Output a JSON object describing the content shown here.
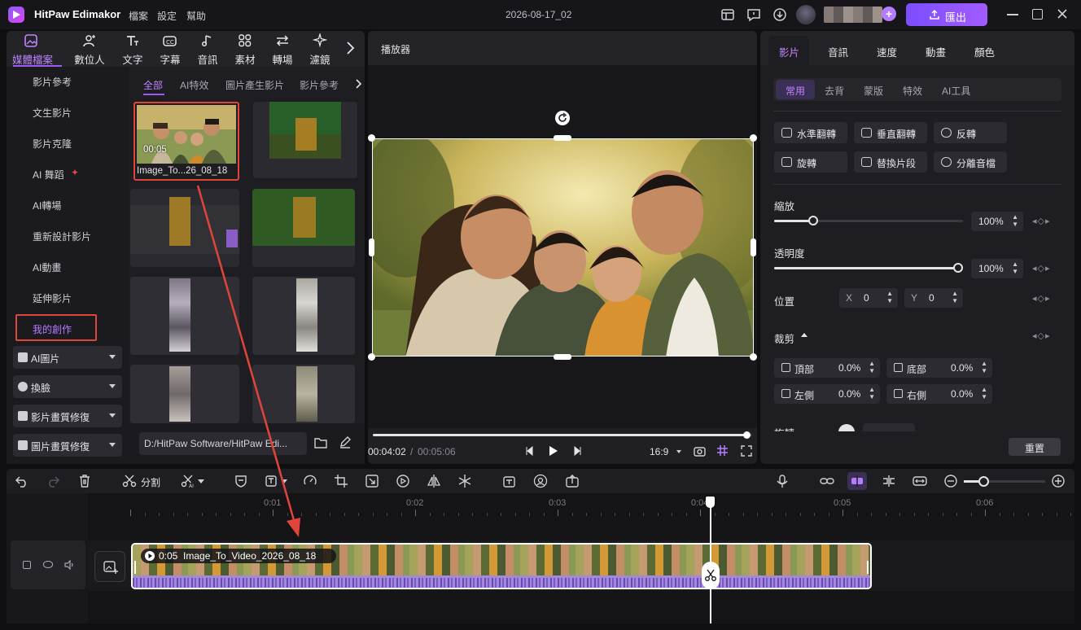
{
  "app": {
    "name": "HitPaw Edimakor",
    "menu": [
      "檔案",
      "設定",
      "幫助"
    ],
    "project_title": "2026-08-17_02",
    "export_label": "匯出"
  },
  "media_tabs": [
    {
      "label": "媒體檔案",
      "icon": "media-icon",
      "active": true
    },
    {
      "label": "數位人",
      "icon": "avatar-person-icon"
    },
    {
      "label": "文字",
      "icon": "text-icon"
    },
    {
      "label": "字幕",
      "icon": "subtitle-icon"
    },
    {
      "label": "音訊",
      "icon": "music-icon"
    },
    {
      "label": "素材",
      "icon": "elements-icon"
    },
    {
      "label": "轉場",
      "icon": "transition-icon"
    },
    {
      "label": "濾鏡",
      "icon": "filter-icon"
    }
  ],
  "sidebar": {
    "items": [
      "影片參考",
      "文生影片",
      "影片克隆",
      "AI 舞蹈",
      "AI轉場",
      "重新設計影片",
      "AI動畫",
      "延伸影片",
      "我的創作"
    ],
    "dropdowns": [
      "AI圖片",
      "換臉",
      "影片畫質修復",
      "圖片畫質修復"
    ]
  },
  "media_subtabs": [
    "全部",
    "AI特效",
    "圖片產生影片",
    "影片參考"
  ],
  "media_card": {
    "duration": "00:05",
    "name": "Image_To...26_08_18"
  },
  "media_path": "D:/HitPaw Software/HitPaw Edi...",
  "player": {
    "title": "播放器",
    "current_time": "00:04:02",
    "separator": "/",
    "total_time": "00:05:06",
    "aspect": "16:9",
    "progress": 0.985
  },
  "right_panel": {
    "tabs": [
      "影片",
      "音訊",
      "速度",
      "動畫",
      "顏色"
    ],
    "subtabs": [
      "常用",
      "去背",
      "蒙版",
      "特效",
      "AI工具"
    ],
    "buttons": [
      "水準翻轉",
      "垂直翻轉",
      "反轉",
      "旋轉",
      "替換片段",
      "分離音檔"
    ],
    "scale_label": "縮放",
    "scale_value": "100%",
    "opacity_label": "透明度",
    "opacity_value": "100%",
    "position_label": "位置",
    "pos_x_label": "X",
    "pos_x_value": "0",
    "pos_y_label": "Y",
    "pos_y_value": "0",
    "crop_label": "裁剪",
    "crop": [
      {
        "label": "頂部",
        "value": "0.0%"
      },
      {
        "label": "底部",
        "value": "0.0%"
      },
      {
        "label": "左側",
        "value": "0.0%"
      },
      {
        "label": "右側",
        "value": "0.0%"
      }
    ],
    "rotate_label": "旋轉",
    "reset_label": "重置"
  },
  "timeline": {
    "split_label": "分割",
    "ruler": [
      "0:01",
      "0:02",
      "0:03",
      "0:04",
      "0:05",
      "0:06"
    ],
    "clip_label": "0:05  Image_To_Video_2026_08_18"
  },
  "colors": {
    "accent": "#9b5cf6",
    "accent_light": "#b57cff",
    "highlight_red": "#e0443a"
  }
}
